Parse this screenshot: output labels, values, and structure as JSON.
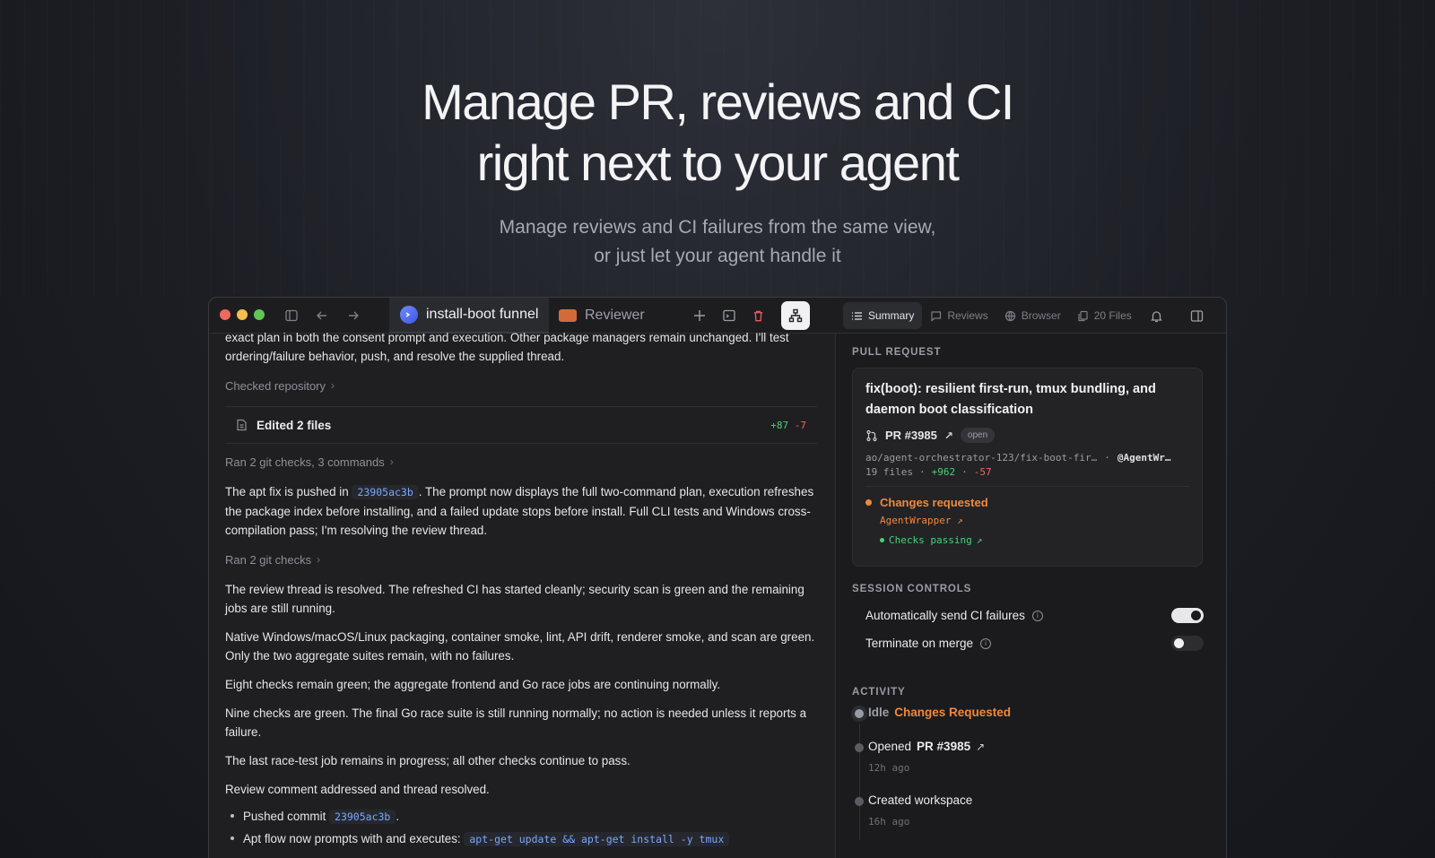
{
  "hero": {
    "title_line1": "Manage PR, reviews and CI",
    "title_line2": "right next to your agent",
    "subtitle_line1": "Manage reviews and CI failures from the same view,",
    "subtitle_line2": "or just let your agent handle it"
  },
  "tabs": [
    {
      "label": "install-boot funnel",
      "active": true
    },
    {
      "label": "Reviewer",
      "active": false
    }
  ],
  "right_tabs": [
    {
      "label": "Summary",
      "active": true,
      "icon": "list-icon"
    },
    {
      "label": "Reviews",
      "active": false,
      "icon": "comment-icon"
    },
    {
      "label": "Browser",
      "active": false,
      "icon": "globe-icon"
    },
    {
      "label": "20 Files",
      "active": false,
      "icon": "files-icon"
    }
  ],
  "chat": {
    "intro": "exact plan in both the consent prompt and execution. Other package managers remain unchanged. I'll test ordering/failure behavior, push, and resolve the supplied thread.",
    "checked_repo": "Checked repository",
    "edited_files": "Edited 2 files",
    "edited_plus": "+87",
    "edited_minus": "-7",
    "ran_checks_1": "Ran 2 git checks, 3 commands",
    "pushed_prefix": "The apt fix is pushed in",
    "commit_hash": "23905ac3b",
    "pushed_suffix": ". The prompt now displays the full two-command plan, execution refreshes the package index before installing, and a failed update stops before install. Full CLI tests and Windows cross-compilation pass; I'm resolving the review thread.",
    "ran_checks_2": "Ran 2 git checks",
    "msg1": "The review thread is resolved. The refreshed CI has started cleanly; security scan is green and the remaining jobs are still running.",
    "msg2": "Native Windows/macOS/Linux packaging, container smoke, lint, API drift, renderer smoke, and scan are green. Only the two aggregate suites remain, with no failures.",
    "msg3": "Eight checks remain green; the aggregate frontend and Go race jobs are continuing normally.",
    "msg4": "Nine checks are green. The final Go race suite is still running normally; no action is needed unless it reports a failure.",
    "msg5": "The last race-test job remains in progress; all other checks continue to pass.",
    "msg6": "Review comment addressed and thread resolved.",
    "bullet1_prefix": "Pushed commit",
    "bullet1_code": "23905ac3b",
    "bullet1_suffix": ".",
    "bullet2_prefix": "Apt flow now prompts with and executes:",
    "bullet2_code": "apt-get update && apt-get install -y tmux"
  },
  "pull_request": {
    "heading": "PULL REQUEST",
    "title": "fix(boot): resilient first-run, tmux bundling, and daemon boot classification",
    "number": "PR #3985",
    "state": "open",
    "branch": "ao/agent-orchestrator-123/fix-boot-fir…",
    "author": "@AgentWr…",
    "files": "19 files",
    "additions": "+962",
    "deletions": "-57",
    "review_status": "Changes requested",
    "reviewer": "AgentWrapper",
    "checks": "Checks passing"
  },
  "session_controls": {
    "heading": "SESSION CONTROLS",
    "items": [
      {
        "label": "Automatically send CI failures",
        "enabled": true
      },
      {
        "label": "Terminate on merge",
        "enabled": false
      }
    ]
  },
  "activity": {
    "heading": "ACTIVITY",
    "items": [
      {
        "prefix": "Idle",
        "highlight": "Changes Requested",
        "time": ""
      },
      {
        "prefix": "Opened",
        "highlight": "PR #3985",
        "time": "12h ago"
      },
      {
        "prefix": "Created workspace",
        "highlight": "",
        "time": "16h ago"
      }
    ]
  },
  "colors": {
    "accent_orange": "#f0883e",
    "accent_green": "#4fcf78",
    "accent_red": "#f06464",
    "code_blue": "#7aa7ff"
  }
}
